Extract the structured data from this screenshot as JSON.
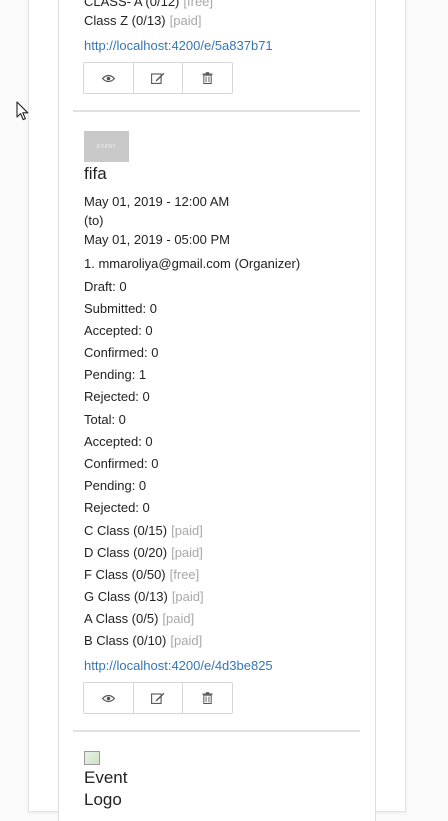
{
  "prev_event": {
    "partial_line": "CLASS- A (0/12)",
    "partial_tag": "[free]",
    "class_line": "Class Z (0/13)",
    "class_tag": "[paid]",
    "url": "http://localhost:4200/e/5a837b71"
  },
  "event": {
    "logo_text": "EVENT",
    "title": "fifa",
    "start": "May 01, 2019 - 12:00 AM",
    "to": "(to)",
    "end": "May 01, 2019 - 05:00 PM",
    "organizer": "1. mmaroliya@gmail.com (Organizer)",
    "stats": [
      "Draft: 0",
      "Submitted: 0",
      "Accepted: 0",
      "Confirmed: 0",
      "Pending: 1",
      "Rejected: 0",
      "Total: 0",
      "Accepted: 0",
      "Confirmed: 0",
      "Pending: 0",
      "Rejected: 0"
    ],
    "classes": [
      {
        "label": "C Class (0/15)",
        "tag": "[paid]"
      },
      {
        "label": "D Class (0/20)",
        "tag": "[paid]"
      },
      {
        "label": "F Class (0/50)",
        "tag": "[free]"
      },
      {
        "label": "G Class (0/13)",
        "tag": "[paid]"
      },
      {
        "label": "A Class (0/5)",
        "tag": "[paid]"
      },
      {
        "label": "B Class (0/10)",
        "tag": "[paid]"
      }
    ],
    "url": "http://localhost:4200/e/4d3be825"
  },
  "next_event": {
    "logo_alt_line1": "Event",
    "logo_alt_line2": "Logo"
  },
  "icons": {
    "view": "eye-icon",
    "edit": "edit-icon",
    "delete": "trash-icon"
  }
}
